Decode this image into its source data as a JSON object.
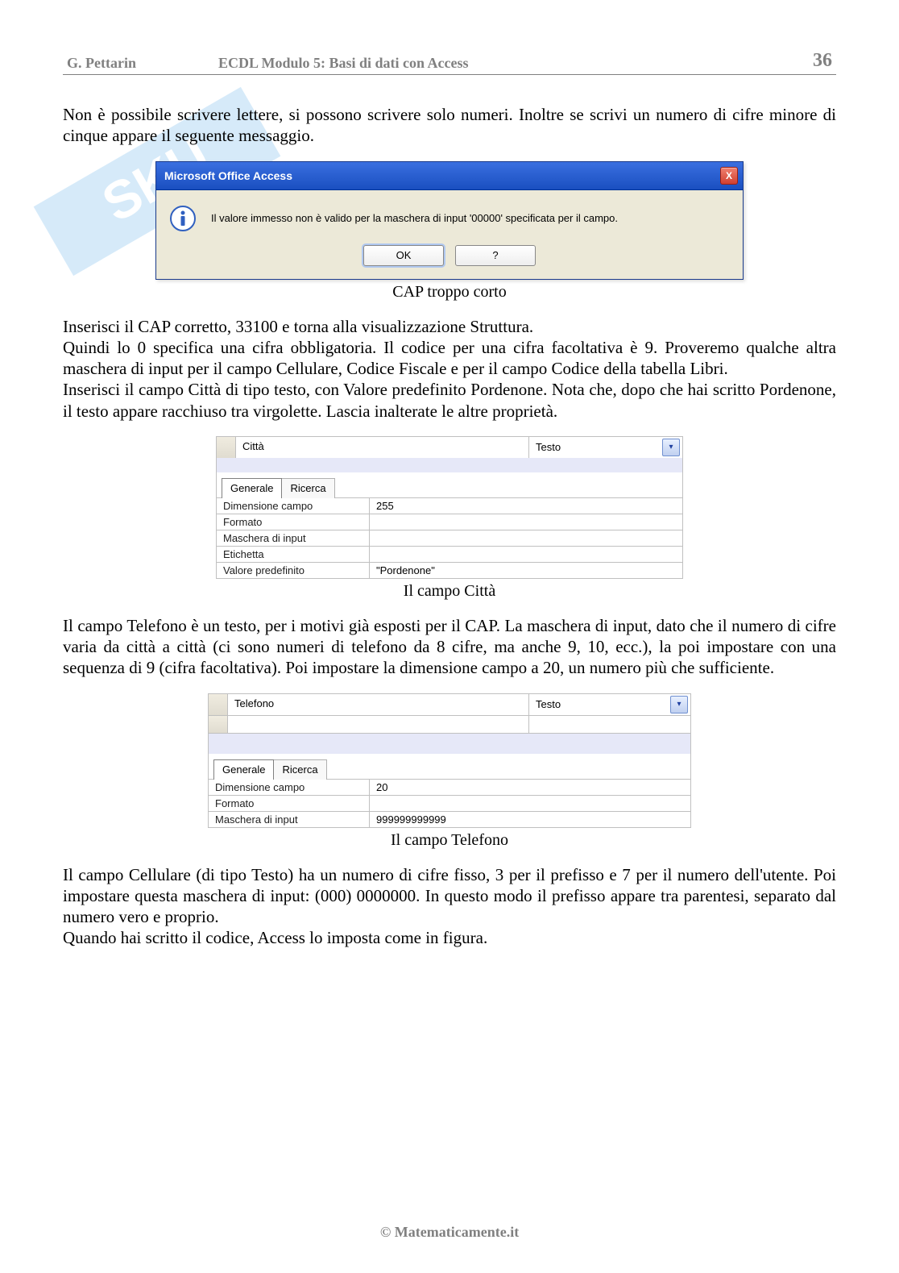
{
  "header": {
    "author": "G. Pettarin",
    "title": "ECDL Modulo 5: Basi di dati con Access",
    "page": "36"
  },
  "para1": "Non è possibile scrivere lettere, si possono scrivere solo numeri. Inoltre se scrivi un numero di cifre minore di cinque appare il seguente messaggio.",
  "dialog": {
    "title": "Microsoft Office Access",
    "close": "X",
    "message": "Il valore immesso non è valido per la maschera di input '00000' specificata per il campo.",
    "ok": "OK",
    "help": "?"
  },
  "caption1": "CAP troppo corto",
  "para2": "Inserisci il CAP corretto, 33100 e torna alla visualizzazione Struttura.",
  "para3": "Quindi lo 0 specifica una cifra obbligatoria. Il codice per una cifra facoltativa è 9. Proveremo qualche altra maschera di input per il campo Cellulare, Codice Fiscale e per il campo Codice della tabella Libri.",
  "para4": "Inserisci il campo Città di tipo testo, con Valore predefinito Pordenone. Nota che, dopo che hai scritto Pordenone, il testo appare racchiuso tra virgolette. Lascia inalterate le altre proprietà.",
  "citta": {
    "fieldName": "Città",
    "fieldType": "Testo",
    "tabs": {
      "generale": "Generale",
      "ricerca": "Ricerca"
    },
    "props": [
      {
        "label": "Dimensione campo",
        "value": "255"
      },
      {
        "label": "Formato",
        "value": ""
      },
      {
        "label": "Maschera di input",
        "value": ""
      },
      {
        "label": "Etichetta",
        "value": ""
      },
      {
        "label": "Valore predefinito",
        "value": "\"Pordenone\""
      }
    ]
  },
  "caption2": "Il campo Città",
  "para5": "Il campo Telefono è un testo, per i motivi già esposti per il CAP. La maschera di input, dato che il numero di cifre varia da città a città (ci sono numeri di telefono da 8 cifre, ma anche 9, 10, ecc.), la poi impostare con una sequenza di 9 (cifra facoltativa). Poi impostare la dimensione campo a 20, un numero più che sufficiente.",
  "telefono": {
    "fieldName": "Telefono",
    "fieldType": "Testo",
    "tabs": {
      "generale": "Generale",
      "ricerca": "Ricerca"
    },
    "props": [
      {
        "label": "Dimensione campo",
        "value": "20"
      },
      {
        "label": "Formato",
        "value": ""
      },
      {
        "label": "Maschera di input",
        "value": "999999999999"
      }
    ]
  },
  "caption3": "Il campo Telefono",
  "para6": "Il campo Cellulare (di tipo Testo) ha un numero di cifre fisso, 3 per il prefisso e 7 per il numero dell'utente. Poi impostare questa maschera di input: (000) 0000000. In questo modo il prefisso appare tra parentesi, separato dal numero vero e proprio.",
  "para7": "Quando hai scritto il codice, Access lo imposta come in figura.",
  "footer": "© Matematicamente.it"
}
